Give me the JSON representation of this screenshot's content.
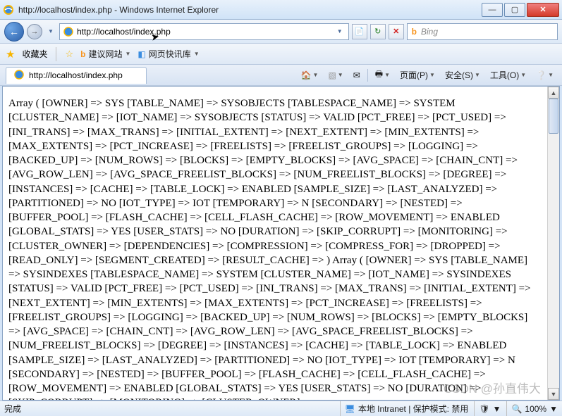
{
  "window": {
    "title": "http://localhost/index.php - Windows Internet Explorer"
  },
  "nav": {
    "url": "http://localhost/index.php",
    "search_engine": "Bing"
  },
  "favbar": {
    "label": "收藏夹",
    "suggested": "建议网站",
    "webslice": "网页快讯库"
  },
  "tab": {
    "title": "http://localhost/index.php"
  },
  "toolbar": {
    "page": "页面(P)",
    "safety": "安全(S)",
    "tools": "工具(O)"
  },
  "status": {
    "done": "完成",
    "zone": "本地 Intranet | 保护模式: 禁用",
    "zoom": "100%"
  },
  "watermark": "CSDN @孙直伟大",
  "body_text": "Array ( [OWNER] => SYS [TABLE_NAME] => SYSOBJECTS [TABLESPACE_NAME] => SYSTEM [CLUSTER_NAME] => [IOT_NAME] => SYSOBJECTS [STATUS] => VALID [PCT_FREE] => [PCT_USED] => [INI_TRANS] => [MAX_TRANS] => [INITIAL_EXTENT] => [NEXT_EXTENT] => [MIN_EXTENTS] => [MAX_EXTENTS] => [PCT_INCREASE] => [FREELISTS] => [FREELIST_GROUPS] => [LOGGING] => [BACKED_UP] => [NUM_ROWS] => [BLOCKS] => [EMPTY_BLOCKS] => [AVG_SPACE] => [CHAIN_CNT] => [AVG_ROW_LEN] => [AVG_SPACE_FREELIST_BLOCKS] => [NUM_FREELIST_BLOCKS] => [DEGREE] => [INSTANCES] => [CACHE] => [TABLE_LOCK] => ENABLED [SAMPLE_SIZE] => [LAST_ANALYZED] => [PARTITIONED] => NO [IOT_TYPE] => IOT [TEMPORARY] => N [SECONDARY] => [NESTED] => [BUFFER_POOL] => [FLASH_CACHE] => [CELL_FLASH_CACHE] => [ROW_MOVEMENT] => ENABLED [GLOBAL_STATS] => YES [USER_STATS] => NO [DURATION] => [SKIP_CORRUPT] => [MONITORING] => [CLUSTER_OWNER] => [DEPENDENCIES] => [COMPRESSION] => [COMPRESS_FOR] => [DROPPED] => [READ_ONLY] => [SEGMENT_CREATED] => [RESULT_CACHE] => ) Array ( [OWNER] => SYS [TABLE_NAME] => SYSINDEXES [TABLESPACE_NAME] => SYSTEM [CLUSTER_NAME] => [IOT_NAME] => SYSINDEXES [STATUS] => VALID [PCT_FREE] => [PCT_USED] => [INI_TRANS] => [MAX_TRANS] => [INITIAL_EXTENT] => [NEXT_EXTENT] => [MIN_EXTENTS] => [MAX_EXTENTS] => [PCT_INCREASE] => [FREELISTS] => [FREELIST_GROUPS] => [LOGGING] => [BACKED_UP] => [NUM_ROWS] => [BLOCKS] => [EMPTY_BLOCKS] => [AVG_SPACE] => [CHAIN_CNT] => [AVG_ROW_LEN] => [AVG_SPACE_FREELIST_BLOCKS] => [NUM_FREELIST_BLOCKS] => [DEGREE] => [INSTANCES] => [CACHE] => [TABLE_LOCK] => ENABLED [SAMPLE_SIZE] => [LAST_ANALYZED] => [PARTITIONED] => NO [IOT_TYPE] => IOT [TEMPORARY] => N [SECONDARY] => [NESTED] => [BUFFER_POOL] => [FLASH_CACHE] => [CELL_FLASH_CACHE] => [ROW_MOVEMENT] => ENABLED [GLOBAL_STATS] => YES [USER_STATS] => NO [DURATION] => [SKIP_CORRUPT] => [MONITORING] => [CLUSTER_OWNER]"
}
